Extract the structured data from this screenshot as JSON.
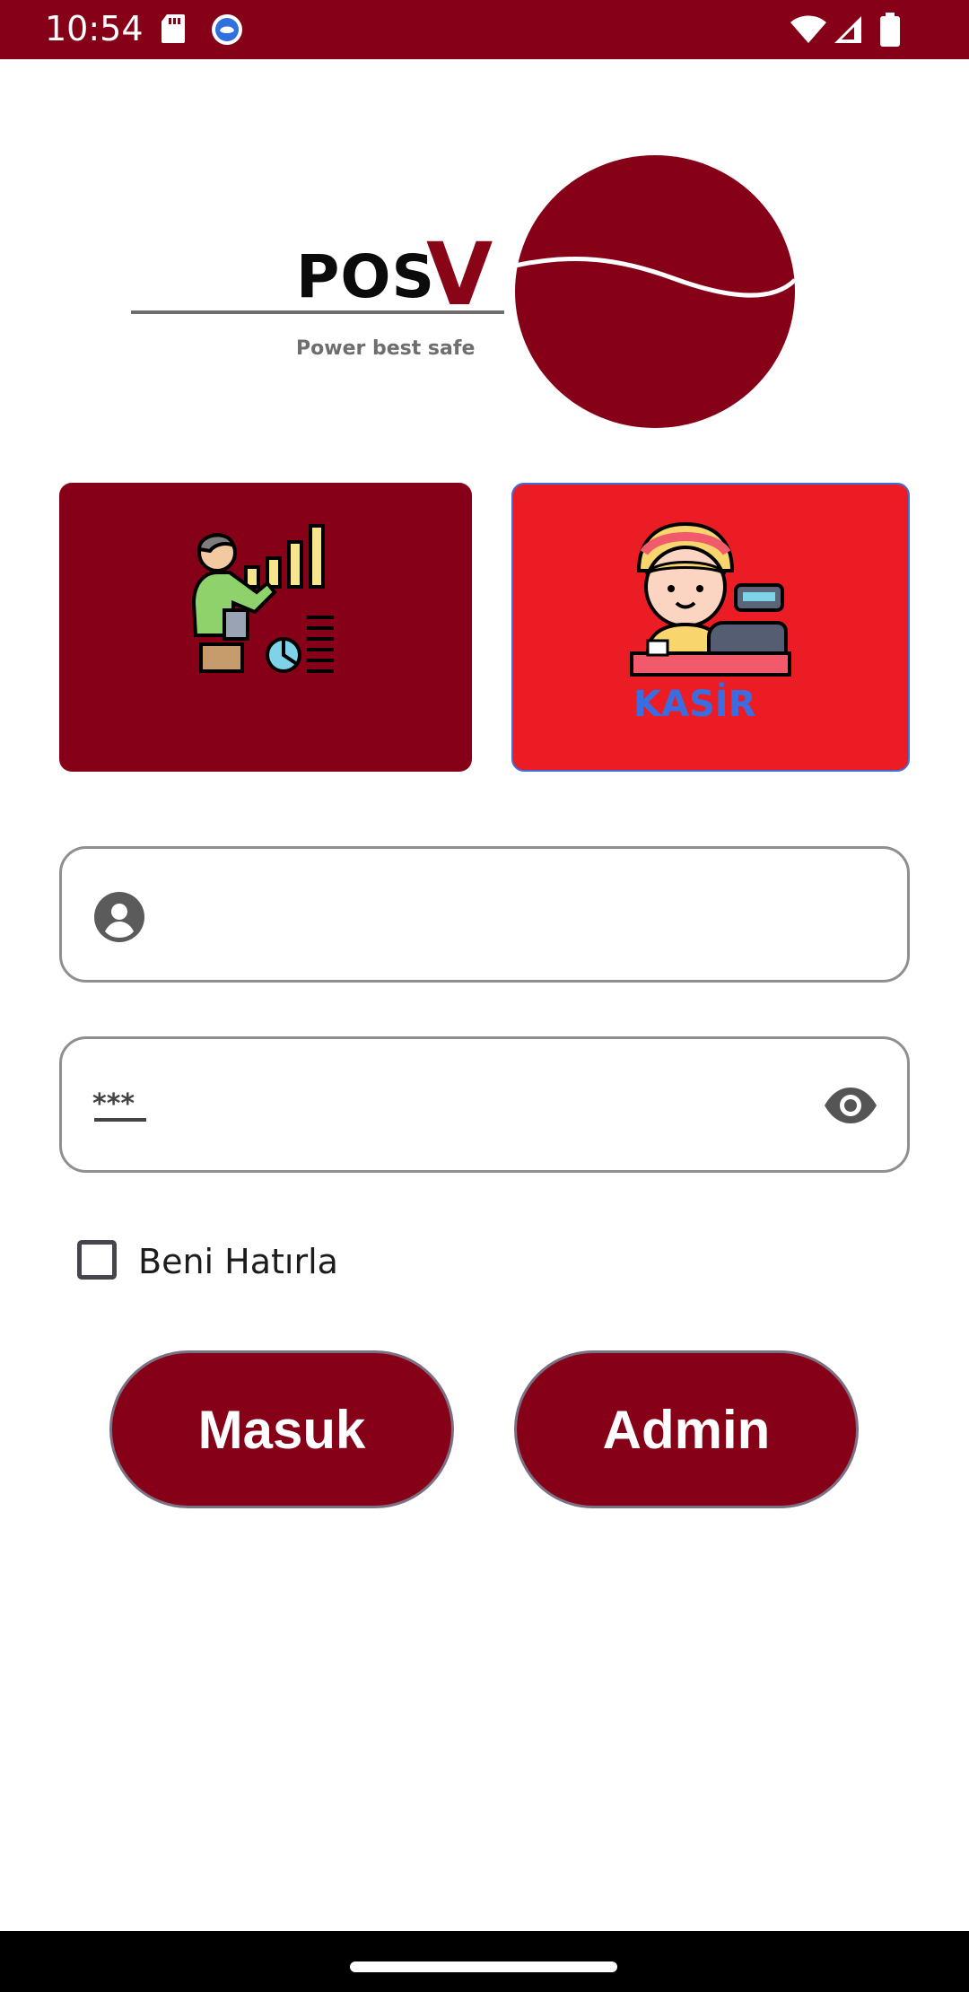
{
  "status_bar": {
    "time": "10:54",
    "colors": {
      "background": "#860017"
    },
    "icons": [
      "sd-card-icon",
      "app-notification-icon",
      "wifi-icon",
      "signal-icon",
      "battery-icon"
    ]
  },
  "logo": {
    "brand_prefix": "POS",
    "brand_suffix": "V",
    "tagline": "Power best safe"
  },
  "roles": {
    "admin_card": {
      "icon": "manager-presentation-icon",
      "color": "#860017"
    },
    "cashier_card": {
      "icon": "cashier-icon",
      "label": "KASİR",
      "color": "#ec1c24",
      "selected": true
    }
  },
  "form": {
    "username": {
      "value": "",
      "placeholder": "",
      "icon": "account-icon"
    },
    "password": {
      "value": "",
      "placeholder": "",
      "icon": "password-icon",
      "toggle_icon": "eye-icon"
    },
    "remember": {
      "label": "Beni Hatırla",
      "checked": false
    }
  },
  "buttons": {
    "login": "Masuk",
    "admin": "Admin"
  },
  "colors": {
    "accent": "#860017",
    "cashier_red": "#ec1c24",
    "border": "#8f8f8f"
  }
}
